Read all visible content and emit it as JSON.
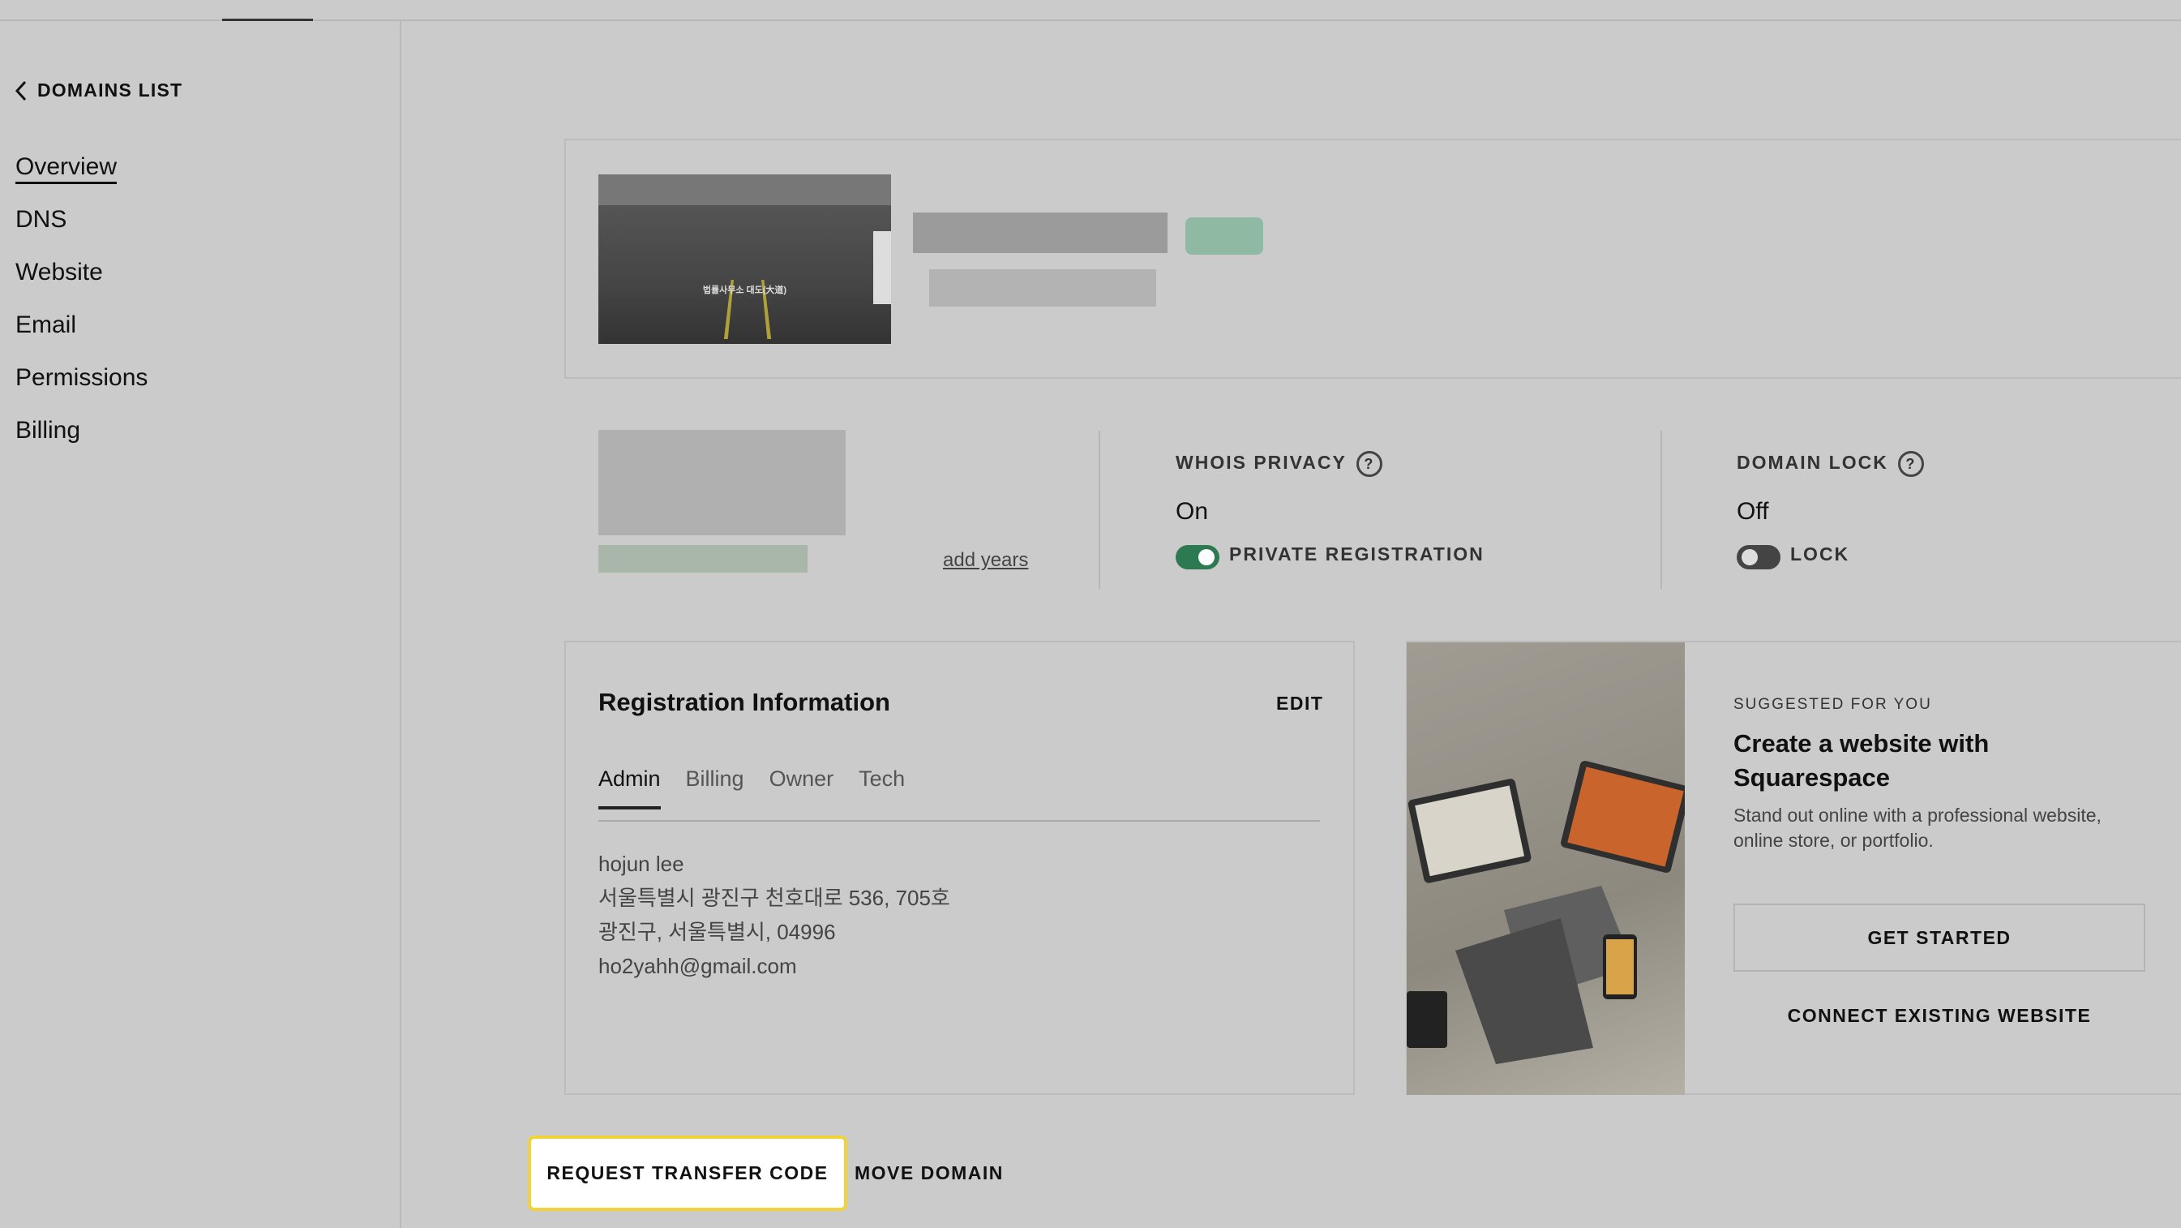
{
  "nav": {
    "back_label": "DOMAINS LIST",
    "items": [
      {
        "label": "Overview"
      },
      {
        "label": "DNS"
      },
      {
        "label": "Website"
      },
      {
        "label": "Email"
      },
      {
        "label": "Permissions"
      },
      {
        "label": "Billing"
      }
    ]
  },
  "thumbnail": {
    "title": "법률사무소 대도(大道)"
  },
  "domain_info": {
    "add_years_label": "add years"
  },
  "whois": {
    "label": "WHOIS PRIVACY",
    "value": "On",
    "toggle_label": "PRIVATE REGISTRATION",
    "toggle_on": true
  },
  "lock": {
    "label": "DOMAIN LOCK",
    "value": "Off",
    "toggle_label": "LOCK",
    "toggle_on": false
  },
  "registration": {
    "title": "Registration Information",
    "edit_label": "EDIT",
    "tabs": [
      "Admin",
      "Billing",
      "Owner",
      "Tech"
    ],
    "active_tab": "Admin",
    "contact": {
      "name": "hojun lee",
      "address1": "서울특별시 광진구 천호대로 536, 705호",
      "address2": "광진구, 서울특별시, 04996",
      "email": "ho2yahh@gmail.com"
    }
  },
  "promo": {
    "eyebrow": "SUGGESTED FOR YOU",
    "title_line1": "Create a website with",
    "title_line2": "Squarespace",
    "desc_line1": "Stand out online with a professional website,",
    "desc_line2": "online store, or portfolio.",
    "primary_label": "GET STARTED",
    "secondary_label": "CONNECT EXISTING WEBSITE"
  },
  "actions": {
    "transfer_label": "REQUEST TRANSFER CODE",
    "move_label": "MOVE DOMAIN"
  },
  "colors": {
    "toggle_on": "#2d7a52",
    "highlight_border": "#f1d23b",
    "background": "#cbcbcb"
  }
}
